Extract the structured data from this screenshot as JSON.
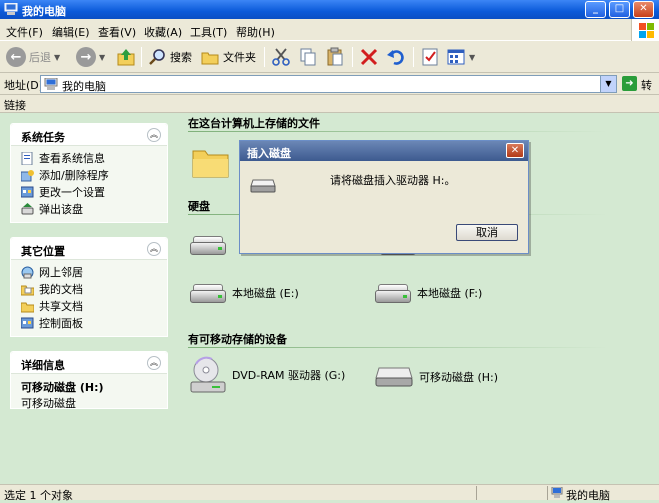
{
  "window": {
    "title": "我的电脑",
    "min_label": "_",
    "max_label": "□",
    "close_label": "✕"
  },
  "menu": [
    "文件(F)",
    "编辑(E)",
    "查看(V)",
    "收藏(A)",
    "工具(T)",
    "帮助(H)"
  ],
  "toolbar": {
    "back_label": "后退",
    "search_label": "搜索",
    "folders_label": "文件夹"
  },
  "address": {
    "label": "地址(D)",
    "value": "我的电脑",
    "go_label": "转到"
  },
  "links": {
    "label": "链接"
  },
  "panes": {
    "system_tasks": {
      "title": "系统任务",
      "items": [
        "查看系统信息",
        "添加/删除程序",
        "更改一个设置",
        "弹出该盘"
      ]
    },
    "other_places": {
      "title": "其它位置",
      "items": [
        "网上邻居",
        "我的文档",
        "共享文档",
        "控制面板"
      ]
    },
    "details": {
      "title": "详细信息",
      "name": "可移动磁盘 (H:)",
      "type": "可移动磁盘"
    }
  },
  "main": {
    "files_section": "在这台计算机上存储的文件",
    "hdd_section": "硬盘",
    "removable_section": "有可移动存储的设备",
    "drive_e": "本地磁盘 (E:)",
    "drive_f": "本地磁盘 (F:)",
    "drive_g": "DVD-RAM 驱动器 (G:)",
    "drive_h": "可移动磁盘 (H:)"
  },
  "dialog": {
    "title": "插入磁盘",
    "message": "请将磁盘插入驱动器 H:。",
    "cancel_label": "取消"
  },
  "status": {
    "left": "选定 1 个对象",
    "right": "我的电脑"
  }
}
